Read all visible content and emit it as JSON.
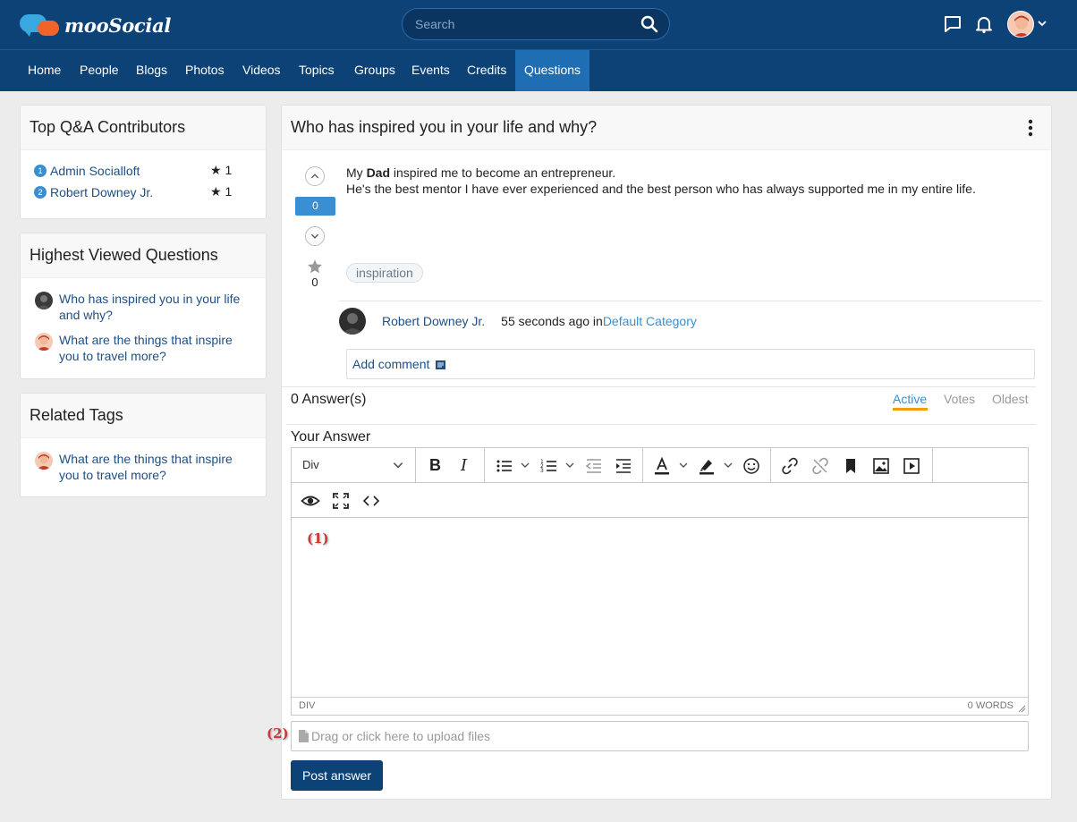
{
  "header": {
    "brand": "mooSocial",
    "search_placeholder": "Search"
  },
  "nav": [
    {
      "label": "Home"
    },
    {
      "label": "People"
    },
    {
      "label": "Blogs"
    },
    {
      "label": "Photos"
    },
    {
      "label": "Videos"
    },
    {
      "label": "Topics"
    },
    {
      "label": "Groups"
    },
    {
      "label": "Events"
    },
    {
      "label": "Credits"
    },
    {
      "label": "Questions",
      "active": true
    }
  ],
  "sidebar": {
    "contributors": {
      "title": "Top Q&A Contributors",
      "items": [
        {
          "rank": "1",
          "name": "Admin Socialloft",
          "score": "★ 1"
        },
        {
          "rank": "2",
          "name": "Robert Downey Jr.",
          "score": "★ 1"
        }
      ]
    },
    "highest_viewed": {
      "title": "Highest Viewed Questions",
      "items": [
        {
          "title": "Who has inspired you in your life and why?"
        },
        {
          "title": "What are the things that inspire you to travel more?"
        }
      ]
    },
    "related_tags": {
      "title": "Related Tags",
      "items": [
        {
          "title": "What are the things that inspire you to travel more?"
        }
      ]
    }
  },
  "question": {
    "title": "Who has inspired you in your life and why?",
    "votes": "0",
    "favorites": "0",
    "body_line1_pre": "My ",
    "body_line1_bold": "Dad",
    "body_line1_post": " inspired me to become an entrepreneur.",
    "body_line2": "He's the best mentor I have ever experienced and the best person who has always supported me in my entire life.",
    "tag": "inspiration",
    "author": "Robert Downey Jr.",
    "time_text": "55 seconds ago in ",
    "category": "Default Category",
    "add_comment": "Add comment"
  },
  "answers": {
    "count_label": "0 Answer(s)",
    "sort_tabs": [
      "Active",
      "Votes",
      "Oldest"
    ],
    "your_answer": "Your Answer",
    "block_format": "Div",
    "marker1": "(1)",
    "marker2": "(2)",
    "status_left": "DIV",
    "status_right": "0 WORDS",
    "upload_placeholder": "Drag or click here to upload files",
    "post_button": "Post answer"
  },
  "colors": {
    "header_bg": "#0d4276",
    "nav_active": "#1f6db2",
    "link": "#1d4f85",
    "accent_blue": "#3a8fd3",
    "accent_orange": "#f39c12"
  }
}
